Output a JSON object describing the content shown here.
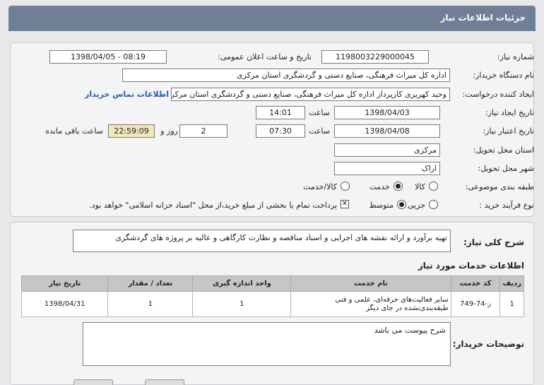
{
  "header": {
    "title": "جزئیات اطلاعات نیاز"
  },
  "fields": {
    "need_number_label": "شماره نیاز:",
    "need_number": "1198003229000045",
    "announce_label": "تاریخ و ساعت اعلان عمومی:",
    "announce_value": "1398/04/05 - 08:19",
    "buyer_org_label": "نام دستگاه خریدار:",
    "buyer_org": "اداره کل میراث فرهنگی، صنایع دستی و گردشگری استان مرکزی",
    "requester_label": "ایجاد کننده درخواست:",
    "requester": "وحید کهریزی کارپرداز اداره کل میراث فرهنگی، صنایع دستی و گردشگری استان مرکزی",
    "contact_link": "اطلاعات تماس خریدار",
    "created_label": "تاریخ ایجاد نیاز:",
    "created_date": "1398/04/03",
    "time_label": "ساعت",
    "created_time": "14:01",
    "valid_label": "تاریخ اعتبار نیاز:",
    "valid_date": "1398/04/08",
    "valid_time": "07:30",
    "days_value": "2",
    "day_and_label": "روز و",
    "remaining_time": "22:59:09",
    "remaining_label": "ساعت باقی مانده",
    "province_label": "استان محل تحویل:",
    "province": "مرکزی",
    "city_label": "شهر محل تحویل:",
    "city": "اراک",
    "category_label": "طبقه بندی موضوعی:",
    "cat_goods": "کالا",
    "cat_service": "خدمت",
    "cat_goods_service": "کالا/خدمت",
    "process_label": "نوع فرآیند خرید :",
    "proc_minor": "جزیی",
    "proc_medium": "متوسط",
    "payment_note": "پرداخت تمام یا بخشی از مبلغ خرید،از محل \"اسناد خزانه اسلامی\" خواهد بود."
  },
  "summary": {
    "label": "شرح کلی نیاز:",
    "text": "تهیه برآورد و ارائه نقشه های اجرایی و اسناد مناقصه و نظارت کارگاهی و عالیه بر پروژه های گردشگری"
  },
  "services": {
    "title": "اطلاعات خدمات مورد نیاز",
    "columns": [
      "ردیف",
      "کد خدمت",
      "نام خدمت",
      "واحد اندازه گیری",
      "تعداد / مقدار",
      "تاریخ نیاز"
    ],
    "rows": [
      [
        "1",
        "ز-74-749",
        "سایر فعالیت‌های حرفه‌ای، علمی و فنی طبقه‌بندی‌نشده در جای دیگر",
        "1",
        "1",
        "1398/04/31"
      ]
    ]
  },
  "buyer_notes": {
    "label": "توضیحات خریدار:",
    "text": "شرح پیوست می باشد"
  }
}
